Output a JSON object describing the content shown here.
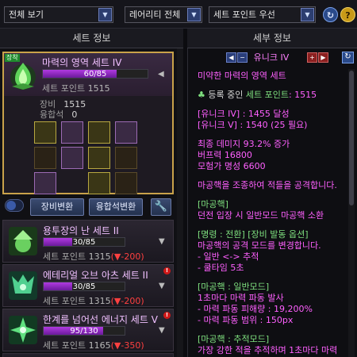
{
  "filters": {
    "view": "전체 보기",
    "rarity": "레어리티 전체",
    "sort": "세트 포인트 우선",
    "help": "?"
  },
  "headers": {
    "left": "세트 정보",
    "right": "세부 정보"
  },
  "selected_set": {
    "badge": "장착",
    "title": "마력의 영역 세트 IV",
    "progress": {
      "current": 60,
      "max": 85,
      "text": "60/85"
    },
    "point_label": "세트 포인트",
    "point_value": "1515",
    "equip_label": "장비",
    "equip_value": "1515",
    "fusion_label": "융합석",
    "fusion_value": "0"
  },
  "buttons": {
    "equip_change": "장비변환",
    "fusion_change": "융합석변환"
  },
  "set_list": [
    {
      "title": "용투장의 난 세트 II",
      "progress": {
        "current": 30,
        "max": 85,
        "text": "30/85"
      },
      "point_label": "세트 포인트",
      "point_value": "1315",
      "delta": "(▼-200)",
      "new": false
    },
    {
      "title": "에테리얼 오브 아츠 세트 II",
      "progress": {
        "current": 30,
        "max": 85,
        "text": "30/85"
      },
      "point_label": "세트 포인트",
      "point_value": "1315",
      "delta": "(▼-200)",
      "new": true
    },
    {
      "title": "한계를 넘어선 에너지 세트 V",
      "progress": {
        "current": 95,
        "max": 130,
        "text": "95/130"
      },
      "point_label": "세트 포인트",
      "point_value": "1165",
      "delta": "(▼-350)",
      "new": true
    }
  ],
  "detail": {
    "nav_title": "유니크 IV",
    "description": "미약한 마력의 영역 세트",
    "registered_label": "등록 중인",
    "registered_point_label": "세트 포인트",
    "registered_point_value": ": 1515",
    "tier1": "[유니크 IV] : 1455 달성",
    "tier2": "[유니크 V] : 1540 (25 필요)",
    "stat1": "최종 데미지 93.2% 증가",
    "stat2": "버프력 16800",
    "stat3": "모험가 명성 6600",
    "flavor": "마공핵을 조종하여 적들을 공격합니다.",
    "core_head": "[마공핵]",
    "core_desc": "던전 입장 시 일반모드 마공핵 소환",
    "cmd_head": "[명령 : 전환] [장비 발동 옵션]",
    "cmd_desc": "마공핵의 공격 모드를 변경합니다.",
    "cmd_l1": "- 일반 <-> 추적",
    "cmd_l2": "- 쿨타임 5초",
    "normal_head": "[마공핵 : 일반모드]",
    "normal_desc": "1초마다 마력 파동 발사",
    "normal_l1": "- 마력 파동 피해량 : 19,200%",
    "normal_l2": "- 마력 파동 범위 : 150px",
    "chase_head": "[마공핵 : 추적모드]",
    "chase_desc": "가장 강한 적을 추적하며 1초마다 마력"
  },
  "colors": {
    "accent_purple": "#b03ae0",
    "gold_border": "#c9a24a",
    "detail_magenta": "#ff60ff",
    "detail_green": "#7fe07f",
    "decrease_red": "#ff4040"
  }
}
